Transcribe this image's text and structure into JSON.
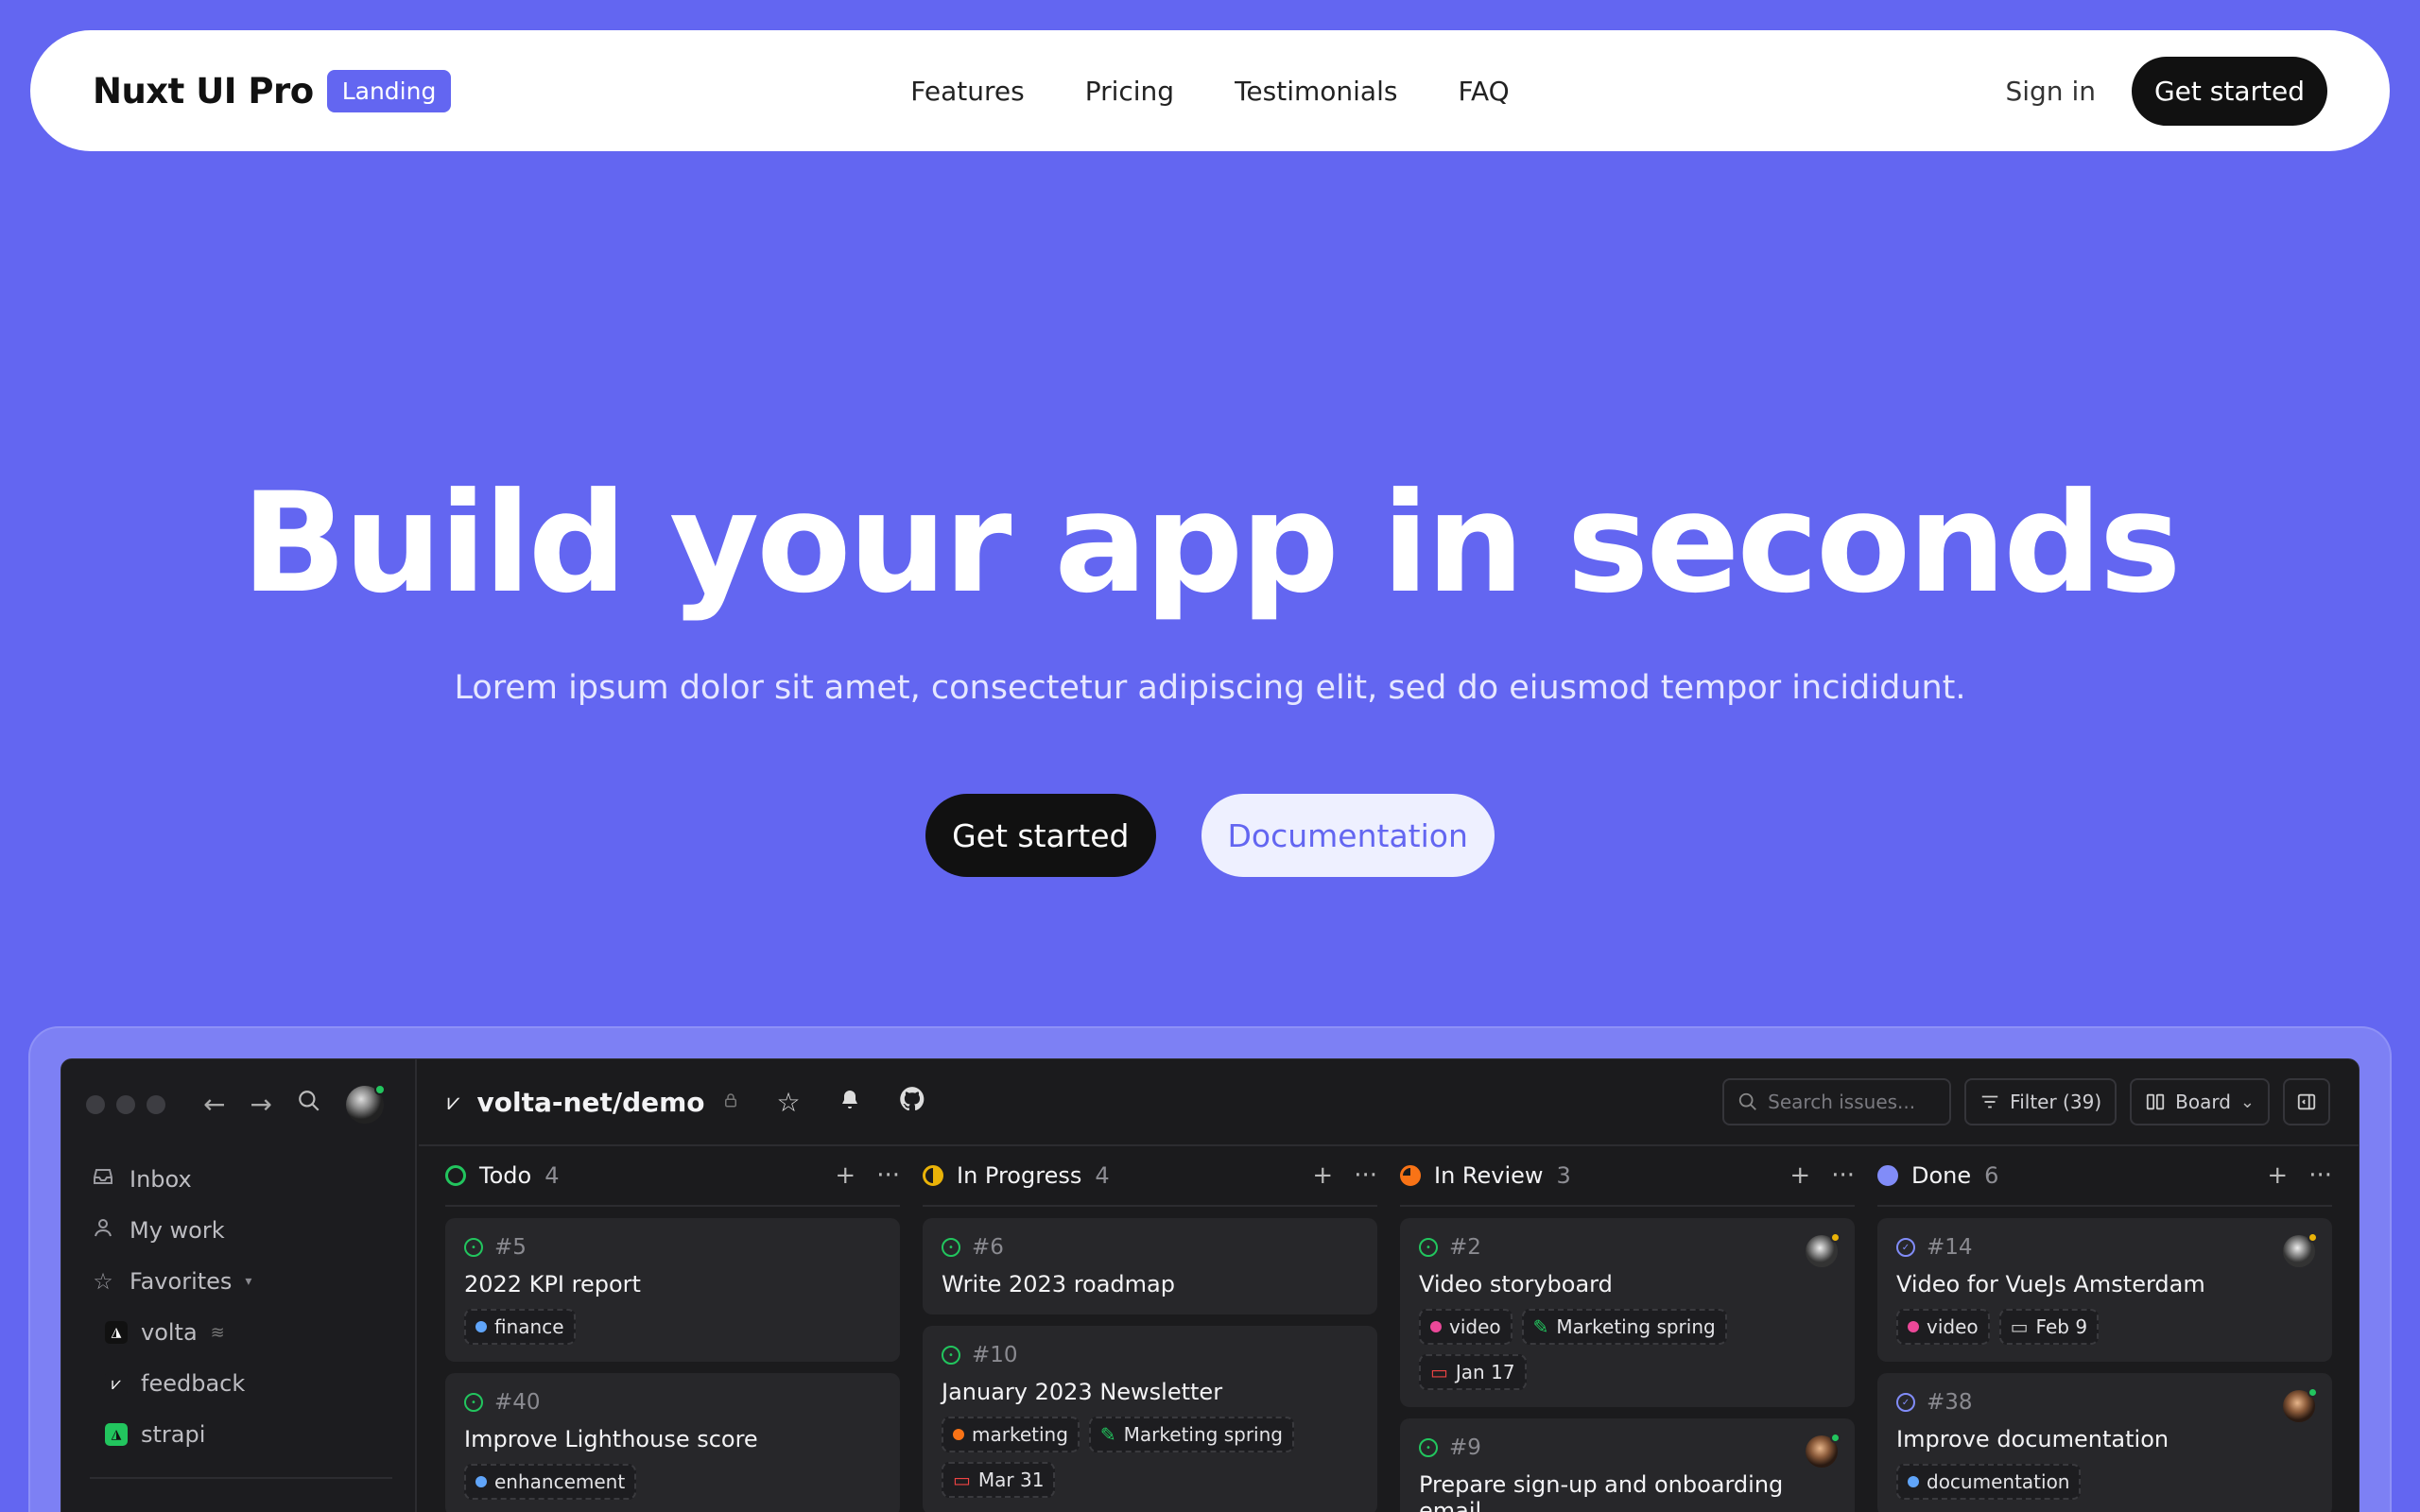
{
  "nav": {
    "brand": "Nuxt UI Pro",
    "badge": "Landing",
    "links": [
      "Features",
      "Pricing",
      "Testimonials",
      "FAQ"
    ],
    "sign_in": "Sign in",
    "get_started": "Get started"
  },
  "hero": {
    "title": "Build your app in seconds",
    "subtitle": "Lorem ipsum dolor sit amet, consectetur adipiscing elit, sed do eiusmod tempor incididunt.",
    "primary_cta": "Get started",
    "secondary_cta": "Documentation"
  },
  "app": {
    "sidebar": {
      "items": [
        {
          "label": "Inbox",
          "icon": "inbox-icon"
        },
        {
          "label": "My work",
          "icon": "user-icon"
        },
        {
          "label": "Favorites",
          "icon": "star-icon"
        }
      ],
      "favorites": [
        {
          "label": "volta",
          "icon": "volta-logo",
          "color": "#111111"
        },
        {
          "label": "feedback",
          "icon": "feedback-logo",
          "color": "#1c1c1f"
        },
        {
          "label": "strapi",
          "icon": "strapi-logo",
          "color": "#22c55e"
        }
      ]
    },
    "topbar": {
      "repo": "volta-net/demo",
      "search_placeholder": "Search issues...",
      "filter_label": "Filter (39)",
      "view_label": "Board"
    },
    "columns": [
      {
        "name": "Todo",
        "count": "4",
        "color": "#22c55e",
        "cards": [
          {
            "id": "#5",
            "title": "2022 KPI report",
            "tags": [
              {
                "label": "finance",
                "color": "#60a5fa"
              }
            ]
          },
          {
            "id": "#40",
            "title": "Improve Lighthouse score",
            "tags": [
              {
                "label": "enhancement",
                "color": "#60a5fa"
              }
            ]
          }
        ]
      },
      {
        "name": "In Progress",
        "count": "4",
        "color": "#eab308",
        "cards": [
          {
            "id": "#6",
            "title": "Write 2023 roadmap",
            "tags": []
          },
          {
            "id": "#10",
            "title": "January 2023 Newsletter",
            "tags": [
              {
                "label": "marketing",
                "color": "#f97316"
              },
              {
                "label": "Marketing spring",
                "color": "#22c55e"
              }
            ],
            "date": "Mar 31"
          }
        ]
      },
      {
        "name": "In Review",
        "count": "3",
        "color": "#f97316",
        "cards": [
          {
            "id": "#2",
            "title": "Video storyboard",
            "tags": [
              {
                "label": "video",
                "color": "#ec4899"
              },
              {
                "label": "Marketing spring",
                "color": "#22c55e"
              }
            ],
            "date": "Jan 17"
          },
          {
            "id": "#9",
            "title": "Prepare sign-up and onboarding email",
            "tags": []
          }
        ]
      },
      {
        "name": "Done",
        "count": "6",
        "color": "#818cf8",
        "cards": [
          {
            "id": "#14",
            "title": "Video for VueJs Amsterdam",
            "tags": [
              {
                "label": "video",
                "color": "#ec4899"
              }
            ],
            "date": "Feb 9"
          },
          {
            "id": "#38",
            "title": "Improve documentation",
            "tags": [
              {
                "label": "documentation",
                "color": "#60a5fa"
              }
            ]
          }
        ]
      }
    ]
  }
}
